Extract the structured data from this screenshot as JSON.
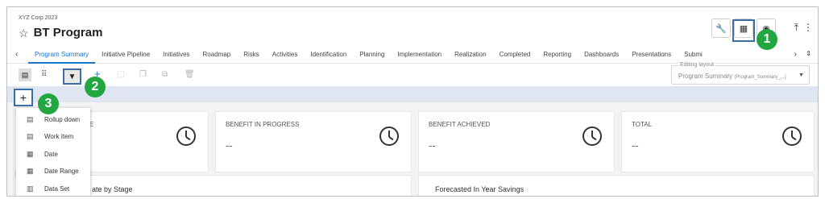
{
  "header": {
    "org": "XYZ Corp 2023",
    "star_icon": "☆",
    "title": "BT Program"
  },
  "top_right": {
    "wrench_icon": "wrench-icon",
    "layout_icon": "grid-icon",
    "db_icon": "database-icon",
    "upload_icon": "upload-icon",
    "more_icon": "more-vertical-icon"
  },
  "tabs": {
    "prev": "‹",
    "next": "›",
    "items": [
      {
        "label": "Program Summary"
      },
      {
        "label": "Initiative Pipeline"
      },
      {
        "label": "Initiatives"
      },
      {
        "label": "Roadmap"
      },
      {
        "label": "Risks"
      },
      {
        "label": "Activities"
      },
      {
        "label": "Identification"
      },
      {
        "label": "Planning"
      },
      {
        "label": "Implementation"
      },
      {
        "label": "Realization"
      },
      {
        "label": "Completed"
      },
      {
        "label": "Reporting"
      },
      {
        "label": "Dashboards"
      },
      {
        "label": "Presentations"
      },
      {
        "label": "Submi"
      }
    ]
  },
  "layout_select": {
    "label": "Editing layout",
    "value": "Program Summary",
    "value_suffix": "(Program_Summary_...)"
  },
  "cards": [
    {
      "title": "NE",
      "value": ""
    },
    {
      "title": "BENEFIT IN PROGRESS",
      "value": "--"
    },
    {
      "title": "BENEFIT ACHIEVED",
      "value": "--"
    },
    {
      "title": "TOTAL",
      "value": "--"
    }
  ],
  "charts": [
    {
      "title": "ate by Stage"
    },
    {
      "title": "Forecasted In Year Savings"
    }
  ],
  "add_menu": {
    "button": "+",
    "items": [
      {
        "label": "Rollup down",
        "icon": "doc-icon"
      },
      {
        "label": "Work Item",
        "icon": "doc-icon"
      },
      {
        "label": "Date",
        "icon": "calendar-icon"
      },
      {
        "label": "Date Range",
        "icon": "calendar-icon"
      },
      {
        "label": "Data Set",
        "icon": "table-icon"
      }
    ]
  },
  "callouts": [
    "1",
    "2",
    "3"
  ],
  "colors": {
    "accent": "#1a73c4",
    "callout_green": "#21a642",
    "highlight_blue": "#3b6ea5",
    "band": "#dfe6f2"
  }
}
